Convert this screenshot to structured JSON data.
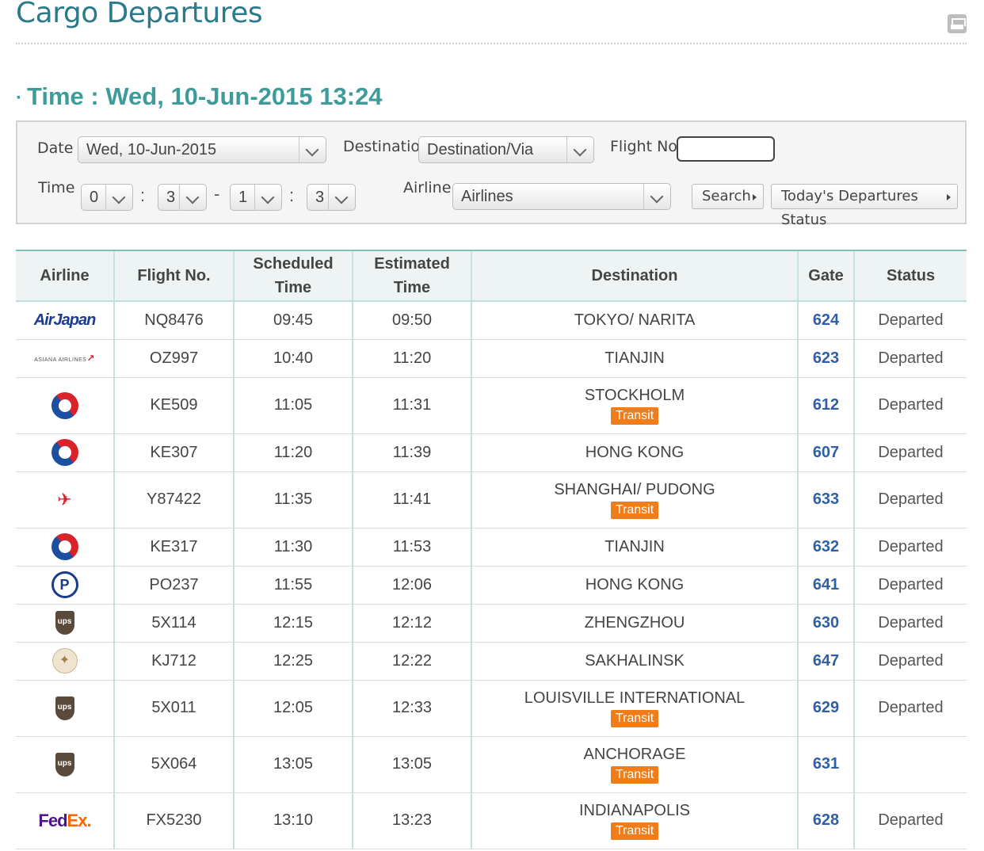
{
  "header": {
    "title": "Cargo Departures",
    "time_label": "Time : Wed, 10-Jun-2015 13:24"
  },
  "search": {
    "date_label": "Date",
    "date_value": "Wed, 10-Jun-2015",
    "destination_label": "Destination",
    "destination_value": "Destination/Via",
    "flight_no_label": "Flight No.",
    "flight_no_value": "",
    "time_label": "Time",
    "time_from_hour": "0",
    "time_from_min": "3",
    "time_to_hour": "1",
    "time_to_min": "3",
    "time_sep": ":",
    "range_sep": "-",
    "airline_label": "Airline",
    "airline_value": "Airlines",
    "search_button": "Search",
    "status_button": "Today's Departures Status"
  },
  "table": {
    "headers": {
      "airline": "Airline",
      "flight_no": "Flight No.",
      "scheduled_1": "Scheduled",
      "scheduled_2": "Time",
      "estimated_1": "Estimated",
      "estimated_2": "Time",
      "destination": "Destination",
      "gate": "Gate",
      "status": "Status"
    },
    "transit_label": "Transit",
    "rows": [
      {
        "logo": "airjapan-logo",
        "logo_text": "AirJapan",
        "flight": "NQ8476",
        "scheduled": "09:45",
        "estimated": "09:50",
        "destination": "TOKYO/ NARITA",
        "transit": false,
        "gate": "624",
        "status": "Departed"
      },
      {
        "logo": "asiana-logo",
        "logo_text": "ASIANA AIRLINES",
        "flight": "OZ997",
        "scheduled": "10:40",
        "estimated": "11:20",
        "destination": "TIANJIN",
        "transit": false,
        "gate": "623",
        "status": "Departed"
      },
      {
        "logo": "korean-air-logo",
        "logo_text": "",
        "flight": "KE509",
        "scheduled": "11:05",
        "estimated": "11:31",
        "destination": "STOCKHOLM",
        "transit": true,
        "gate": "612",
        "status": "Departed"
      },
      {
        "logo": "korean-air-logo",
        "logo_text": "",
        "flight": "KE307",
        "scheduled": "11:20",
        "estimated": "11:39",
        "destination": "HONG KONG",
        "transit": false,
        "gate": "607",
        "status": "Departed"
      },
      {
        "logo": "yangtze-river-express-logo",
        "logo_text": "",
        "flight": "Y87422",
        "scheduled": "11:35",
        "estimated": "11:41",
        "destination": "SHANGHAI/ PUDONG",
        "transit": true,
        "gate": "633",
        "status": "Departed"
      },
      {
        "logo": "korean-air-logo",
        "logo_text": "",
        "flight": "KE317",
        "scheduled": "11:30",
        "estimated": "11:53",
        "destination": "TIANJIN",
        "transit": false,
        "gate": "632",
        "status": "Departed"
      },
      {
        "logo": "p-logo",
        "logo_text": "P",
        "flight": "PO237",
        "scheduled": "11:55",
        "estimated": "12:06",
        "destination": "HONG KONG",
        "transit": false,
        "gate": "641",
        "status": "Departed"
      },
      {
        "logo": "ups-logo",
        "logo_text": "ups",
        "flight": "5X114",
        "scheduled": "12:15",
        "estimated": "12:12",
        "destination": "ZHENGZHOU",
        "transit": false,
        "gate": "630",
        "status": "Departed"
      },
      {
        "logo": "yakutia-logo",
        "logo_text": "",
        "flight": "KJ712",
        "scheduled": "12:25",
        "estimated": "12:22",
        "destination": "SAKHALINSK",
        "transit": false,
        "gate": "647",
        "status": "Departed"
      },
      {
        "logo": "ups-logo",
        "logo_text": "ups",
        "flight": "5X011",
        "scheduled": "12:05",
        "estimated": "12:33",
        "destination": "LOUISVILLE INTERNATIONAL",
        "transit": true,
        "gate": "629",
        "status": "Departed"
      },
      {
        "logo": "ups-logo",
        "logo_text": "ups",
        "flight": "5X064",
        "scheduled": "13:05",
        "estimated": "13:05",
        "destination": "ANCHORAGE",
        "transit": true,
        "gate": "631",
        "status": ""
      },
      {
        "logo": "fedex-logo",
        "logo_text": "FedEx",
        "flight": "FX5230",
        "scheduled": "13:10",
        "estimated": "13:23",
        "destination": "INDIANAPOLIS",
        "transit": true,
        "gate": "628",
        "status": "Departed"
      }
    ]
  },
  "colors": {
    "title": "#2b7a8c",
    "time_heading": "#3d9c9a",
    "gate": "#2f5fa6",
    "transit_badge": "#f07d1a",
    "header_bg": "#edf4f3"
  }
}
